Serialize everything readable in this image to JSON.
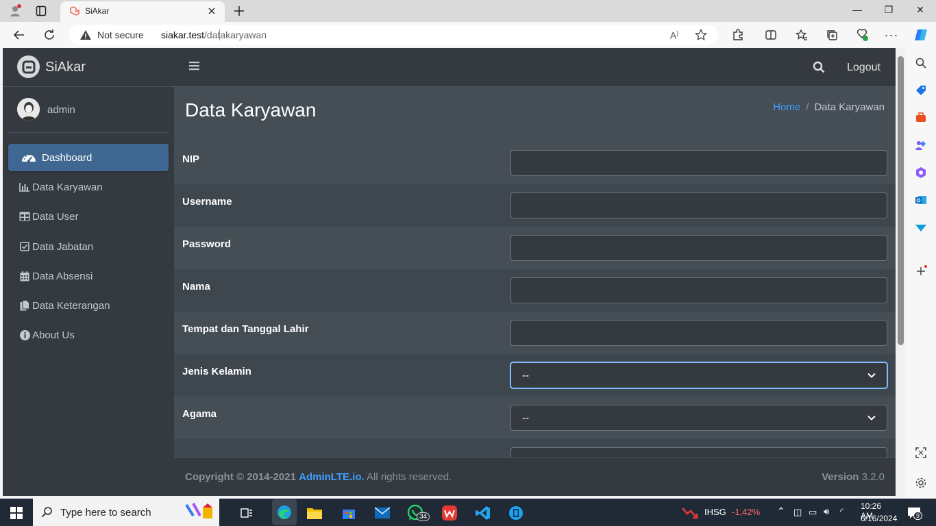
{
  "browser": {
    "tab_title": "SiAkar",
    "not_secure": "Not secure",
    "url_host": "siakar.test",
    "url_path": "/datakaryawan"
  },
  "app": {
    "brand": "SiAkar",
    "user": "admin",
    "sidebar": [
      {
        "label": "Dashboard",
        "icon": "dashboard-icon",
        "active": true
      },
      {
        "label": "Data Karyawan",
        "icon": "chart-bar-icon"
      },
      {
        "label": "Data User",
        "icon": "table-icon"
      },
      {
        "label": "Data Jabatan",
        "icon": "check-square-icon"
      },
      {
        "label": "Data Absensi",
        "icon": "calendar-icon"
      },
      {
        "label": "Data Keterangan",
        "icon": "copy-icon"
      },
      {
        "label": "About Us",
        "icon": "info-circle-icon"
      }
    ],
    "topnav": {
      "logout": "Logout"
    },
    "page_title": "Data Karyawan",
    "breadcrumb": {
      "home": "Home",
      "sep": "/",
      "current": "Data Karyawan"
    },
    "form": [
      {
        "label": "NIP",
        "value": ""
      },
      {
        "label": "Username",
        "value": ""
      },
      {
        "label": "Password",
        "value": ""
      },
      {
        "label": "Nama",
        "value": ""
      },
      {
        "label": "Tempat dan Tanggal Lahir",
        "value": ""
      },
      {
        "label": "Jenis Kelamin",
        "value": "--"
      },
      {
        "label": "Agama",
        "value": "--"
      }
    ],
    "footer": {
      "copyright": "Copyright © 2014-2021",
      "link": "AdminLTE.io.",
      "rights": "All rights reserved.",
      "version_label": "Version",
      "version": "3.2.0"
    }
  },
  "taskbar": {
    "search_placeholder": "Type here to search",
    "whatsapp_badge": "34",
    "stock_name": "IHSG",
    "stock_change": "-1,42%",
    "time": "10:26 AM",
    "date": "6/16/2024",
    "notif_count": "9"
  },
  "colors": {
    "sidebar": "#343a40",
    "content": "#454d55",
    "active": "#3f6791",
    "link": "#3f9eff"
  }
}
